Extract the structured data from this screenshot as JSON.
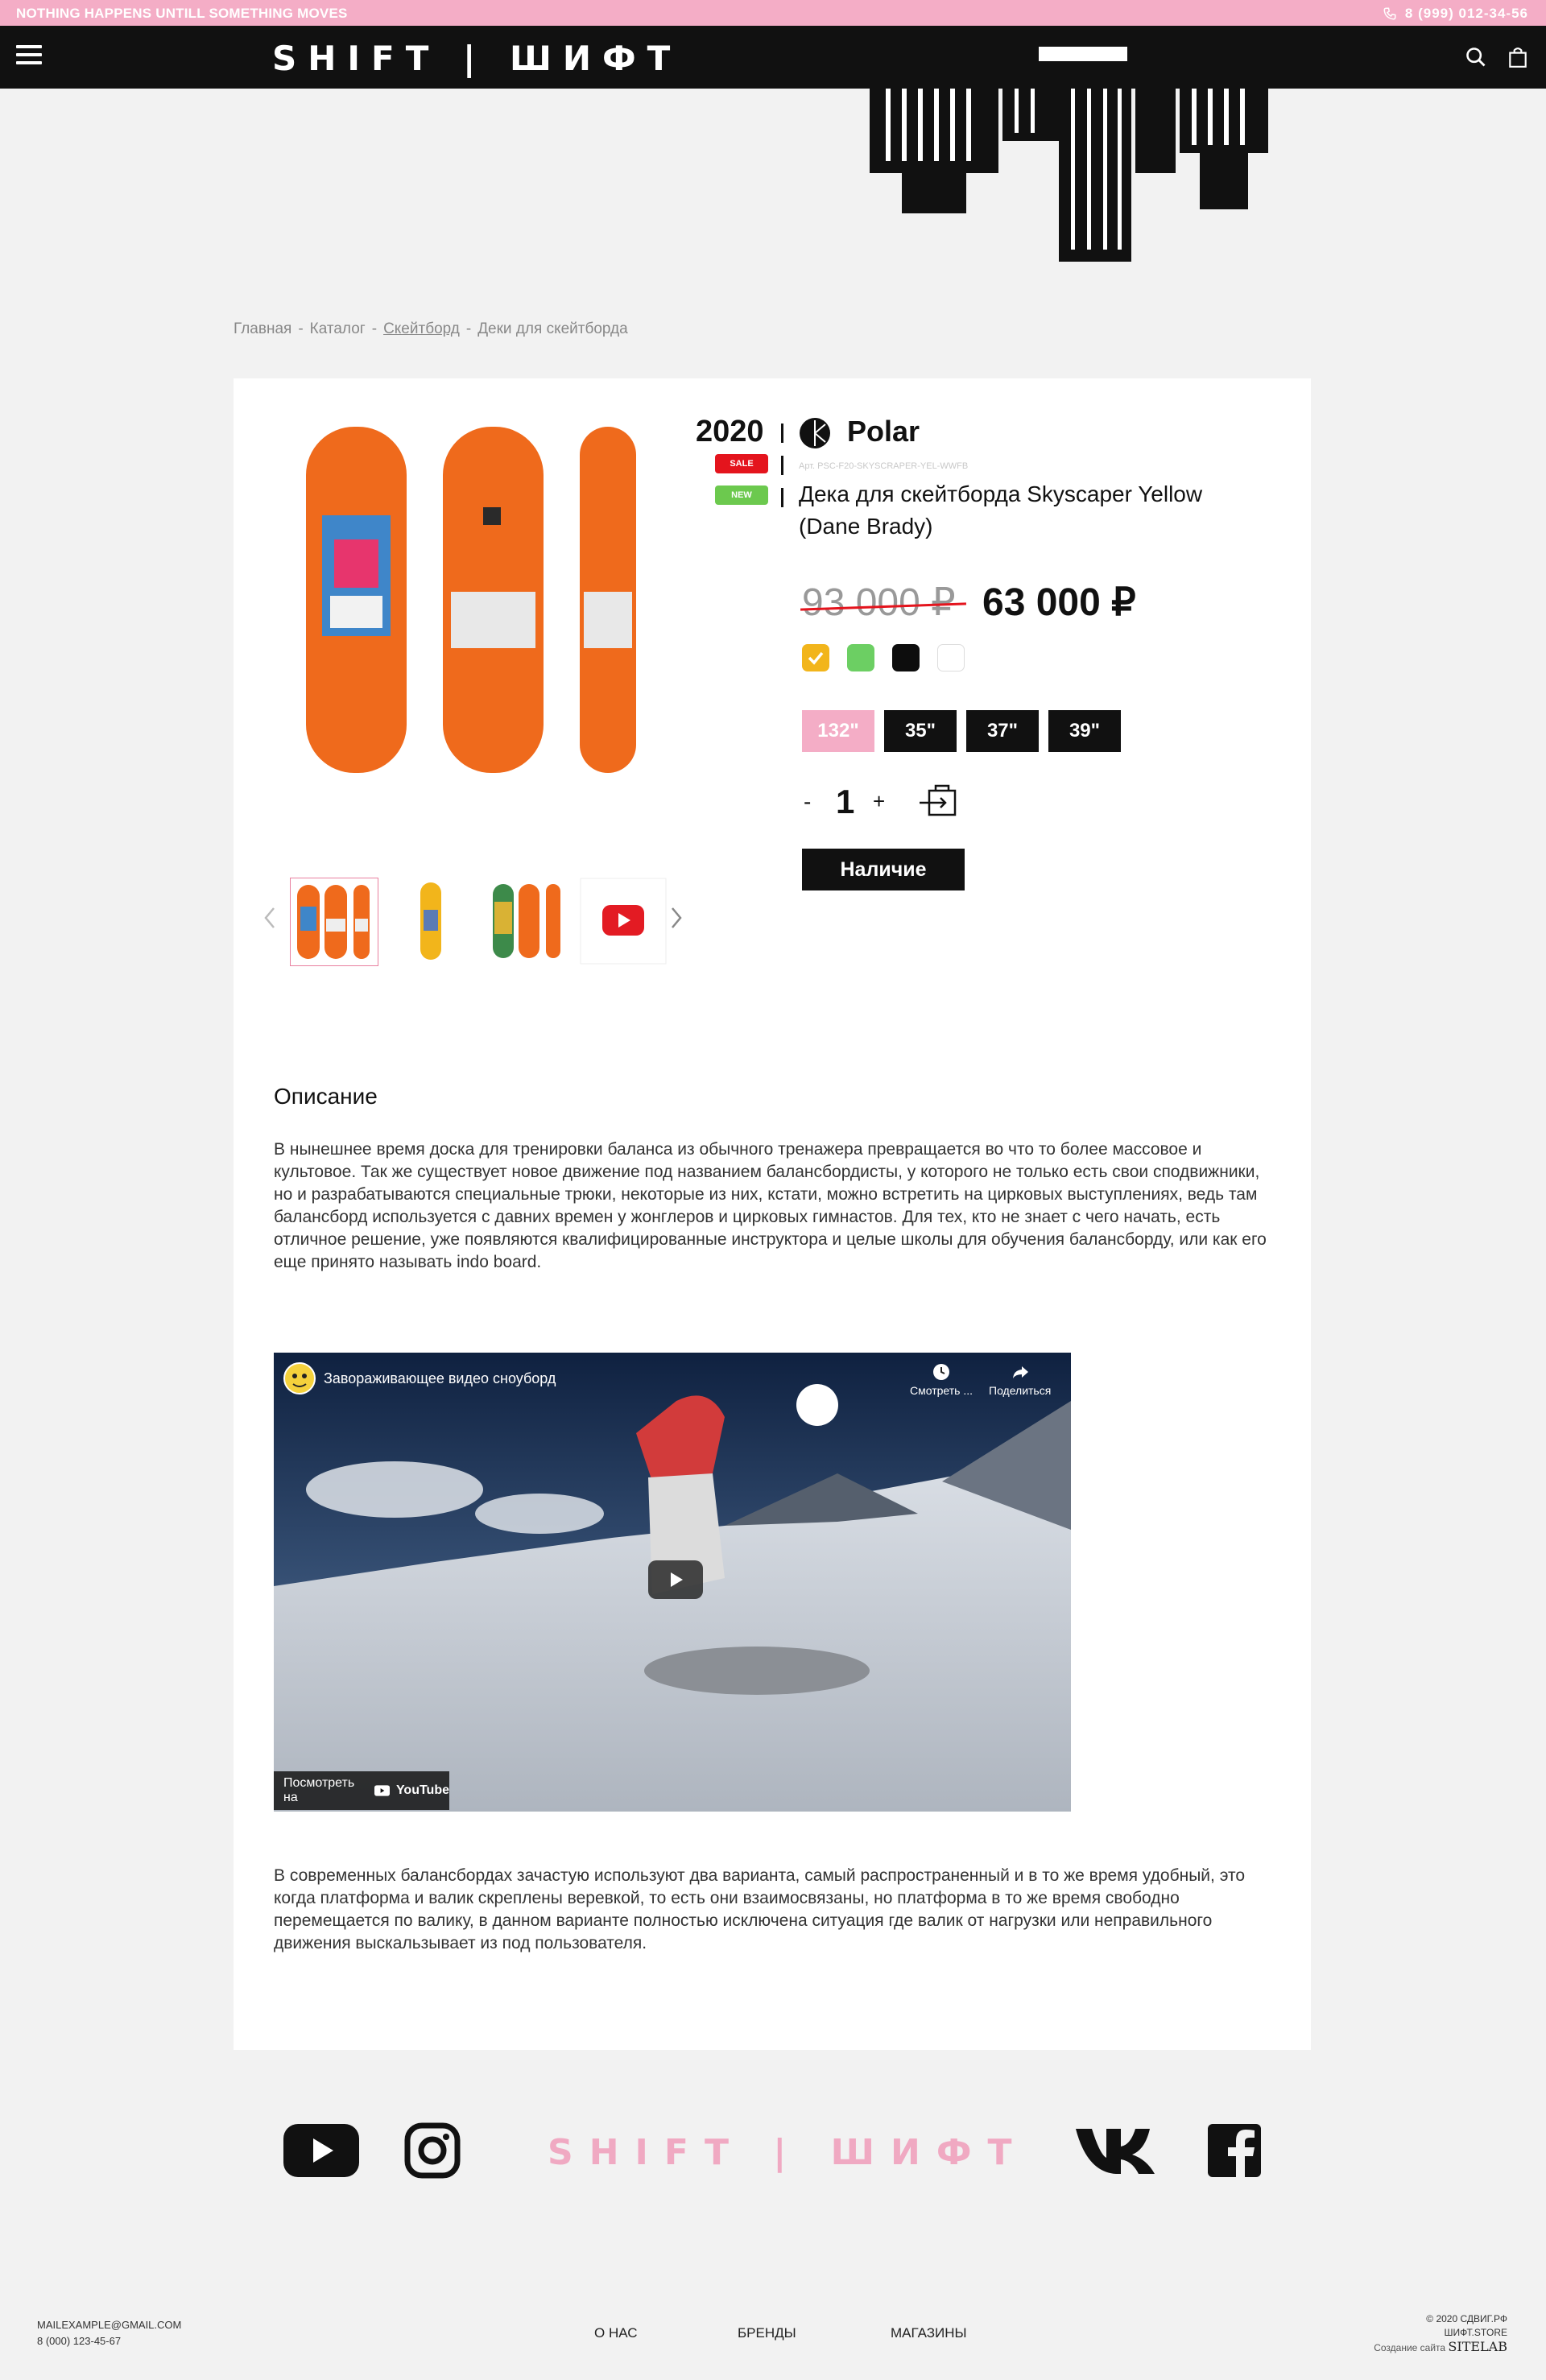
{
  "topbar": {
    "slogan": "NOTHING HAPPENS UNTILL SOMETHING MOVES",
    "phone": "8 (999) 012-34-56"
  },
  "header": {
    "logo": "SHIFT | ШИФТ"
  },
  "breadcrumb": {
    "home": "Главная",
    "catalog": "Каталог",
    "skateboard": "Скейтборд",
    "current": "Деки для скейтборда",
    "sep": "-"
  },
  "product": {
    "year": "2020",
    "brand": "Polar",
    "badge_sale": "SALE",
    "badge_new": "NEW",
    "article": "Арт. PSC-F20-SKYSCRAPER-YEL-WWFB",
    "title": "Дека для скейтборда Skyscaper Yellow (Dane Brady)",
    "old_price": "93 000 ₽",
    "new_price": "63 000 ₽",
    "colors": [
      "#f2b51b",
      "#6ccf63",
      "#0d0d0d",
      "#ffffff"
    ],
    "selected_color_index": 0,
    "sizes": [
      "132\"",
      "35\"",
      "37\"",
      "39\""
    ],
    "selected_size_index": 0,
    "qty_minus": "-",
    "qty": "1",
    "qty_plus": "+",
    "availability_button": "Наличие"
  },
  "description": {
    "heading": "Описание",
    "paragraph1": "В нынешнее время доска для тренировки баланса из обычного тренажера превращается во что то более массовое и культовое. Так же существует новое движение под названием балансбордисты, у которого не только есть свои сподвижники, но и разрабатываются специальные трюки, некоторые из них, кстати, можно встретить на цирковых выступлениях, ведь там балансборд используется с давних времен у жонглеров и цирковых гимнастов. Для тех, кто не знает с чего начать, есть отличное решение, уже появляются квалифицированные инструктора и целые школы для обучения балансборду, или как его еще принято называть indo board.",
    "paragraph2": "В современных балансбордах зачастую используют два варианта, самый распространенный и в то же время удобный, это когда платформа и валик скреплены веревкой, то есть они взаимосвязаны, но платформа в то же время свободно перемещается по валику, в данном варианте полностью исключена ситуация где валик от нагрузки или неправильного движения выскальзывает из под пользователя."
  },
  "video": {
    "title": "Завораживающее видео сноуборд",
    "watch_later": "Смотреть ...",
    "share": "Поделиться",
    "watch_on": "Посмотреть на",
    "youtube": "YouTube"
  },
  "footer": {
    "logo": "SHIFT | ШИФТ",
    "email": "MAILEXAMPLE@GMAIL.COM",
    "phone": "8 (000) 123-45-67",
    "nav": [
      "О НАС",
      "БРЕНДЫ",
      "МАГАЗИНЫ"
    ],
    "copyright": "© 2020 СДВИГ.РФ",
    "store": "ШИФТ.STORE",
    "made_by_label": "Создание сайта",
    "made_by": "SITELAB"
  },
  "icons": {
    "phone": "phone-icon",
    "menu": "menu-icon",
    "search": "search-icon",
    "bag": "bag-icon",
    "cart": "add-to-cart-icon",
    "youtube": "youtube-icon",
    "instagram": "instagram-icon",
    "vk": "vk-icon",
    "facebook": "facebook-icon",
    "play": "play-icon"
  }
}
